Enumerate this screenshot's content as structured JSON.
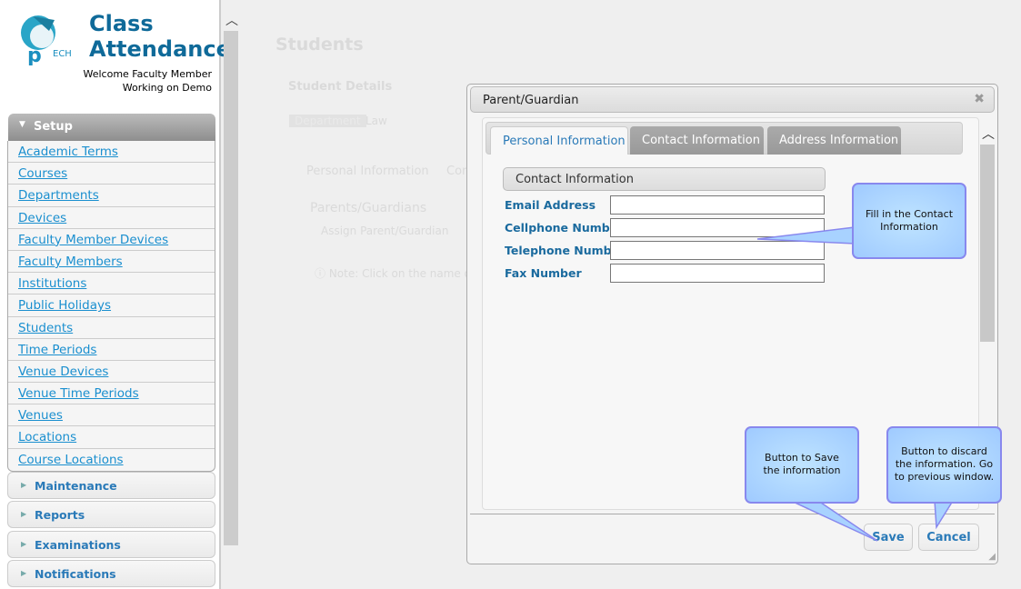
{
  "app": {
    "title_line1": "Class",
    "title_line2": "Attendance",
    "logo_text": "iPTECH",
    "welcome": "Welcome Faculty Member",
    "working_on": "Working on Demo"
  },
  "sidebar": {
    "setup_label": "Setup",
    "setup_items": [
      "Academic Terms",
      "Courses",
      "Departments",
      "Devices",
      "Faculty Member Devices",
      "Faculty Members",
      "Institutions",
      "Public Holidays",
      "Students",
      "Time Periods",
      "Venue Devices",
      "Venue Time Periods",
      "Venues",
      "Locations",
      "Course Locations"
    ],
    "sections": [
      "Maintenance",
      "Reports",
      "Examinations",
      "Notifications"
    ]
  },
  "background_page": {
    "title": "Students",
    "student_details": "Student Details",
    "department_label": "Department",
    "department_value": "Law",
    "tab1": "Personal Information",
    "tab2": "Con",
    "parents_header": "Parents/Guardians",
    "assign_button": "Assign Parent/Guardian",
    "note": "Note: Click on the name of t"
  },
  "dialog": {
    "title": "Parent/Guardian",
    "tabs": [
      "Personal Information",
      "Contact Information",
      "Address Information"
    ],
    "section_title": "Contact Information",
    "fields": [
      {
        "label": "Email Address",
        "value": ""
      },
      {
        "label": "Cellphone Number",
        "value": ""
      },
      {
        "label": "Telephone Number",
        "value": ""
      },
      {
        "label": "Fax Number",
        "value": ""
      }
    ],
    "save_label": "Save",
    "cancel_label": "Cancel"
  },
  "callouts": {
    "contact": "Fill in the Contact Information",
    "save": "Button to Save the information",
    "cancel": "Button to discard the information. Go to previous window."
  },
  "colors": {
    "link": "#1a8fcf",
    "brand": "#0f6a99",
    "callout": "#aad4ff",
    "callout_border": "#8888ee"
  }
}
